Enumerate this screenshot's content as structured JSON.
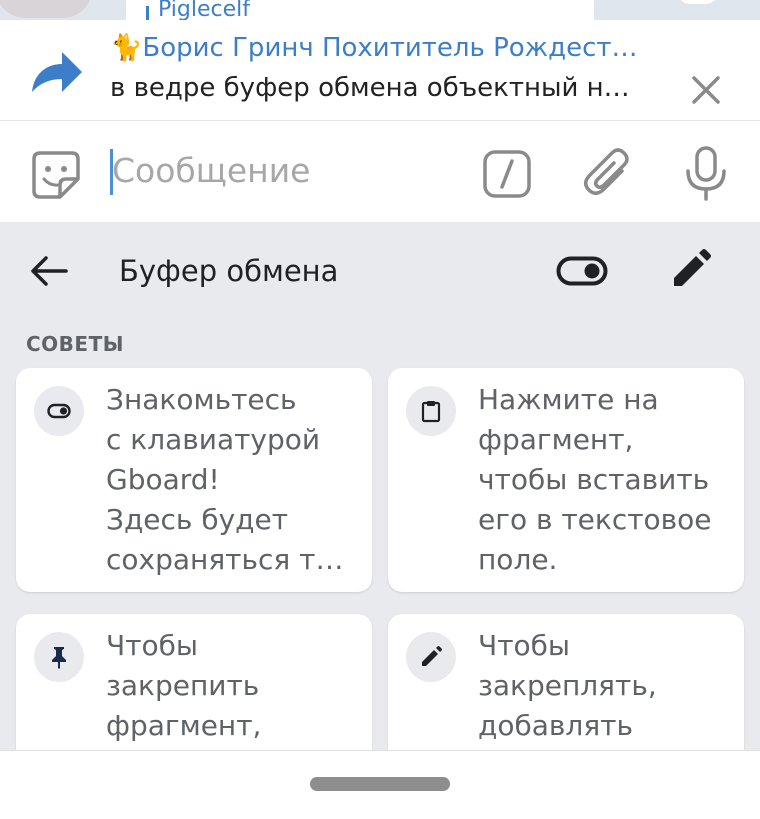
{
  "chat": {
    "reply_text": "Piglecelf"
  },
  "forward": {
    "title": "🐈Борис Гринч Похититель Рождест…",
    "subtitle": "в ведре буфер обмена объектный не…"
  },
  "input": {
    "placeholder": "Сообщение"
  },
  "clipboard": {
    "title": "Буфер обмена",
    "section": "СОВЕТЫ",
    "cards": [
      {
        "icon": "toggle-icon",
        "lines": [
          "Знакомьтесь",
          "с клавиатурой",
          "Gboard!",
          "Здесь будет",
          "сохраняться т…"
        ]
      },
      {
        "icon": "clipboard-icon",
        "lines": [
          "Нажмите на",
          "фрагмент,",
          "чтобы вставить",
          "его в текстовое",
          "поле."
        ]
      },
      {
        "icon": "pin-icon",
        "lines": [
          "Чтобы",
          "закрепить",
          "фрагмент,"
        ]
      },
      {
        "icon": "pencil-icon",
        "lines": [
          "Чтобы",
          "закреплять,",
          "добавлять"
        ]
      }
    ]
  },
  "colors": {
    "accent": "#3d7ec8",
    "panel_bg": "#e8eaed",
    "card_text": "#5f6368"
  }
}
